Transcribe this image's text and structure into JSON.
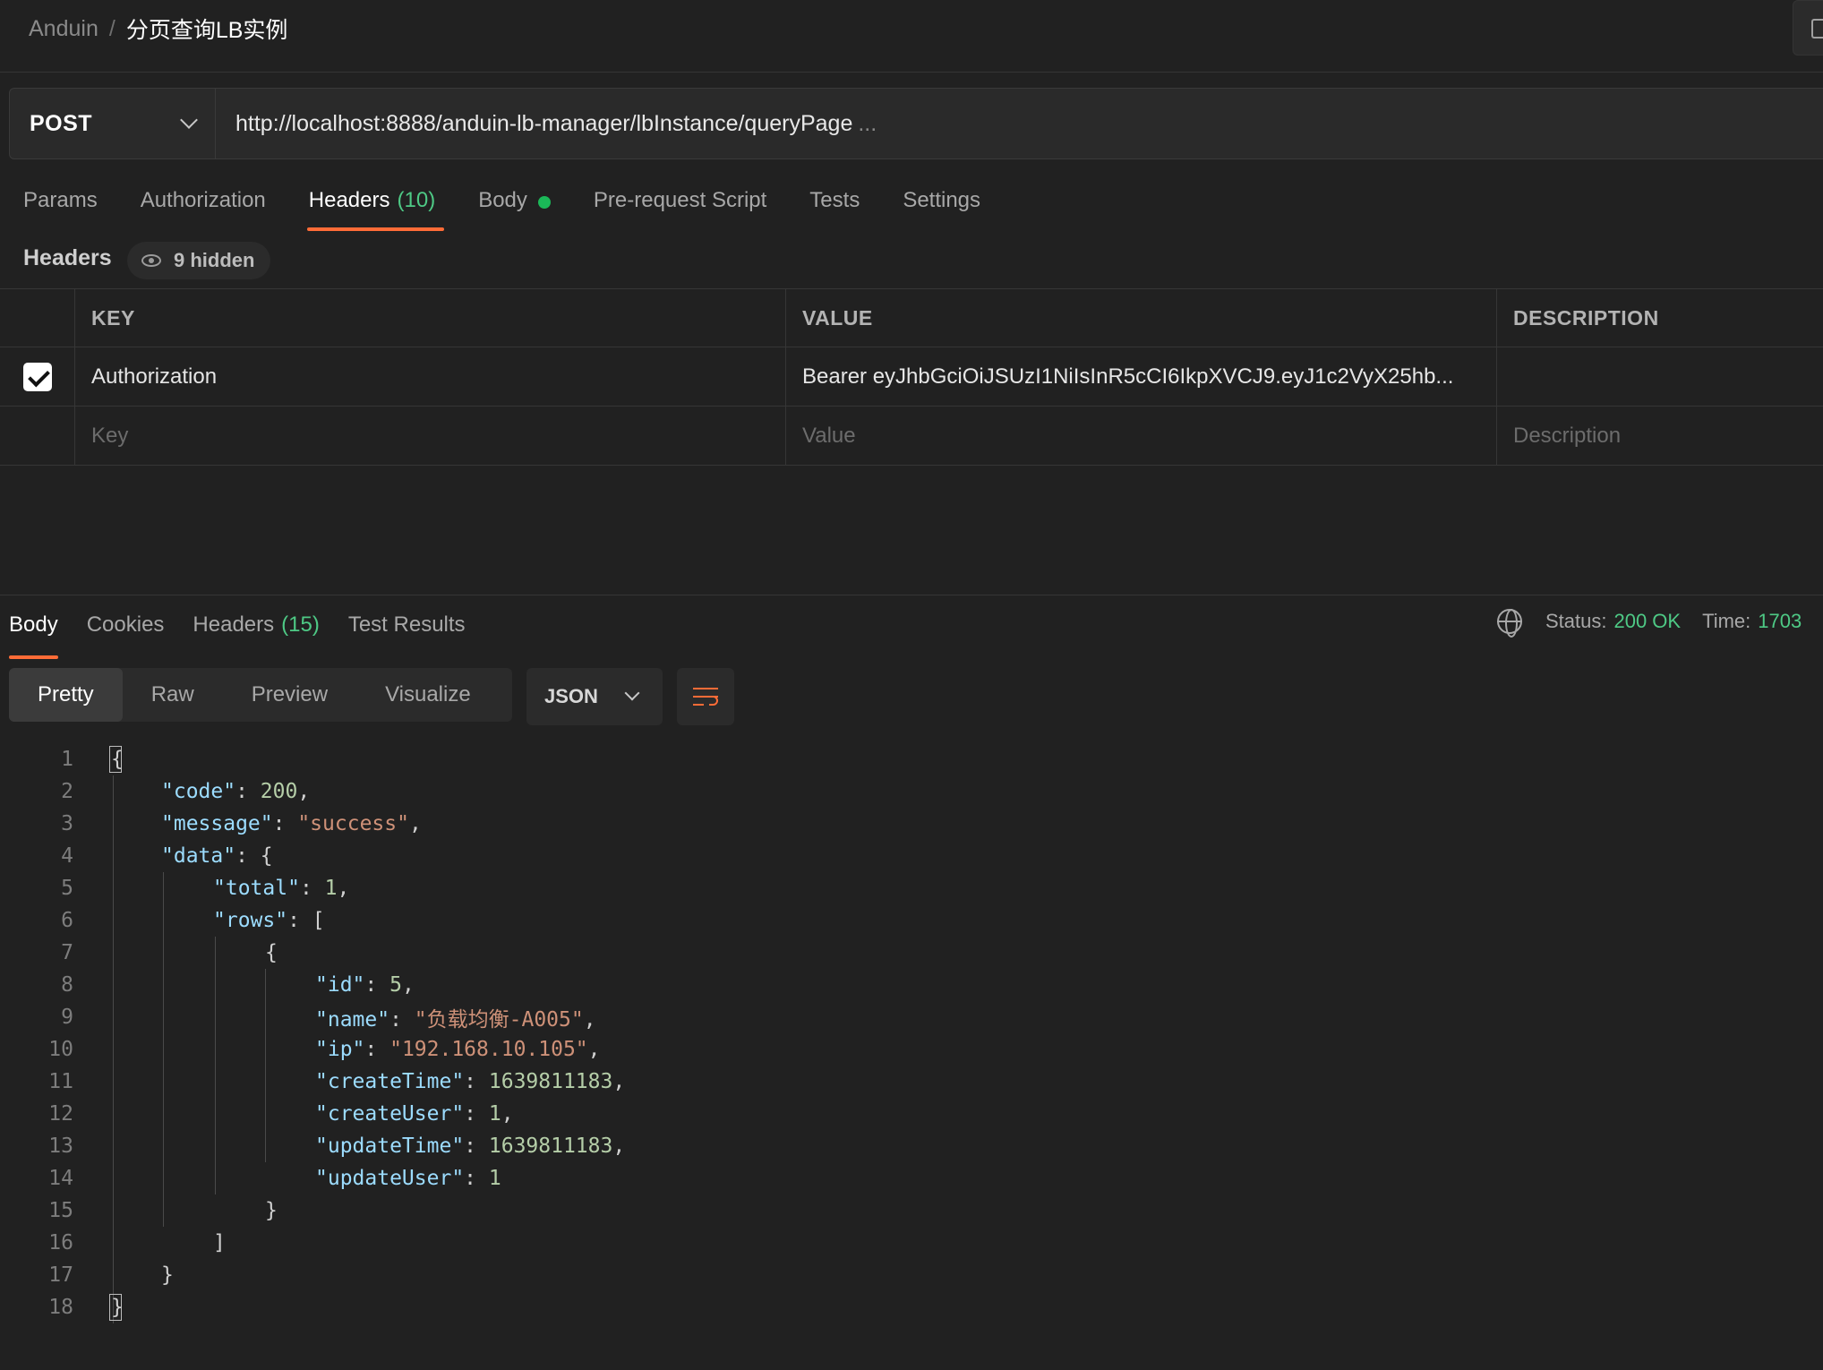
{
  "breadcrumb": {
    "parent": "Anduin",
    "separator": "/",
    "current": "分页查询LB实例"
  },
  "request": {
    "method": "POST",
    "url": "http://localhost:8888/anduin-lb-manager/lbInstance/queryPage",
    "url_overflow": "..."
  },
  "request_tabs": [
    {
      "label": "Params"
    },
    {
      "label": "Authorization"
    },
    {
      "label": "Headers",
      "count": "(10)",
      "active": true
    },
    {
      "label": "Body",
      "has_dot": true
    },
    {
      "label": "Pre-request Script"
    },
    {
      "label": "Tests"
    },
    {
      "label": "Settings"
    }
  ],
  "headers_section": {
    "title": "Headers",
    "hidden_label": "9 hidden"
  },
  "headers_table": {
    "columns": [
      "KEY",
      "VALUE",
      "DESCRIPTION"
    ],
    "rows": [
      {
        "checked": true,
        "key": "Authorization",
        "value": "Bearer eyJhbGciOiJSUzI1NiIsInR5cCI6IkpXVCJ9.eyJ1c2VyX25hb...",
        "description": ""
      }
    ],
    "placeholders": {
      "key": "Key",
      "value": "Value",
      "description": "Description"
    }
  },
  "response_tabs": [
    {
      "label": "Body",
      "active": true
    },
    {
      "label": "Cookies"
    },
    {
      "label": "Headers",
      "count": "(15)"
    },
    {
      "label": "Test Results"
    }
  ],
  "response_status": {
    "status_label": "Status:",
    "status_value": "200 OK",
    "time_label": "Time:",
    "time_value": "1703"
  },
  "view_modes": [
    "Pretty",
    "Raw",
    "Preview",
    "Visualize"
  ],
  "active_view_mode": "Pretty",
  "format": "JSON",
  "icons": {
    "method_dropdown": "chevron-down-icon",
    "hidden_headers": "eye-icon",
    "response_globe": "globe-icon",
    "format_dropdown": "chevron-down-icon",
    "wrap": "wrap-lines-icon"
  },
  "colors": {
    "accent": "#ff6c37",
    "success": "#4ec985",
    "dot": "#1bb858"
  },
  "code_lines": [
    "1",
    "2",
    "3",
    "4",
    "5",
    "6",
    "7",
    "8",
    "9",
    "10",
    "11",
    "12",
    "13",
    "14",
    "15",
    "16",
    "17",
    "18"
  ],
  "response_json": {
    "code_key": "\"code\"",
    "code_val": "200",
    "message_key": "\"message\"",
    "message_val": "\"success\"",
    "data_key": "\"data\"",
    "total_key": "\"total\"",
    "total_val": "1",
    "rows_key": "\"rows\"",
    "id_key": "\"id\"",
    "id_val": "5",
    "name_key": "\"name\"",
    "name_val": "\"负载均衡-A005\"",
    "ip_key": "\"ip\"",
    "ip_val": "\"192.168.10.105\"",
    "createTime_key": "\"createTime\"",
    "createTime_val": "1639811183",
    "createUser_key": "\"createUser\"",
    "createUser_val": "1",
    "updateTime_key": "\"updateTime\"",
    "updateTime_val": "1639811183",
    "updateUser_key": "\"updateUser\"",
    "updateUser_val": "1"
  }
}
